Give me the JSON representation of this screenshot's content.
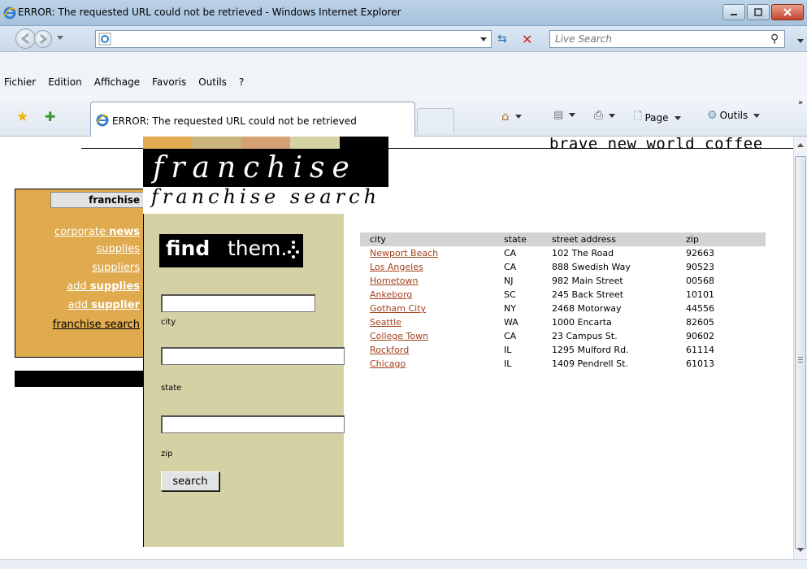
{
  "window": {
    "title": "ERROR: The requested URL could not be retrieved - Windows Internet Explorer"
  },
  "address_bar": {
    "url": "",
    "search_placeholder": "Live Search"
  },
  "menu": [
    "Fichier",
    "Edition",
    "Affichage",
    "Favoris",
    "Outils",
    "?"
  ],
  "command_bar": {
    "tab_title": "ERROR: The requested URL could not be retrieved",
    "page_label": "Page",
    "tools_label": "Outils",
    "chevron": "»"
  },
  "colors": {
    "nav_bg": "#e0aa4e",
    "panel_bg": "#d4d1a4",
    "link": "#a3401c",
    "strip": [
      "#e0aa4e",
      "#c9b57a",
      "#d4a074",
      "#d6d2a4",
      "#000000"
    ]
  },
  "page": {
    "brand": "brave new world coffee",
    "franchise_word": "franchise",
    "section_title": "franchise search",
    "nav": {
      "header": "franchise",
      "items": [
        {
          "pre": "corporate ",
          "bold": "news"
        },
        {
          "pre": "supplies",
          "bold": ""
        },
        {
          "pre": "suppliers",
          "bold": ""
        },
        {
          "pre": "add ",
          "bold": "supplies"
        },
        {
          "pre": "add ",
          "bold": "supplier"
        },
        {
          "pre": "franchise search",
          "bold": ""
        }
      ]
    },
    "find": {
      "logo_bold": "find",
      "logo_rest": "them.",
      "labels": {
        "city": "city",
        "state": "state",
        "zip": "zip"
      },
      "values": {
        "city": "",
        "state": "",
        "zip": ""
      },
      "button": "search"
    },
    "table": {
      "headers": [
        "city",
        "state",
        "street address",
        "zip"
      ],
      "rows": [
        [
          "Newport Beach",
          "CA",
          "102 The Road",
          "92663"
        ],
        [
          "Los Angeles",
          "CA",
          "888 Swedish Way",
          "90523"
        ],
        [
          "Hometown",
          "NJ",
          "982 Main Street",
          "00568"
        ],
        [
          "Ankeborg",
          "SC",
          "245 Back Street",
          "10101"
        ],
        [
          "Gotham City",
          "NY",
          "2468 Motorway",
          "44556"
        ],
        [
          "Seattle",
          "WA",
          "1000 Encarta",
          "82605"
        ],
        [
          "College Town",
          "CA",
          "23 Campus St.",
          "90602"
        ],
        [
          "Rockford",
          "IL",
          "1295 Mulford Rd.",
          "61114"
        ],
        [
          "Chicago",
          "IL",
          "1409 Pendrell St.",
          "61013"
        ]
      ]
    }
  }
}
